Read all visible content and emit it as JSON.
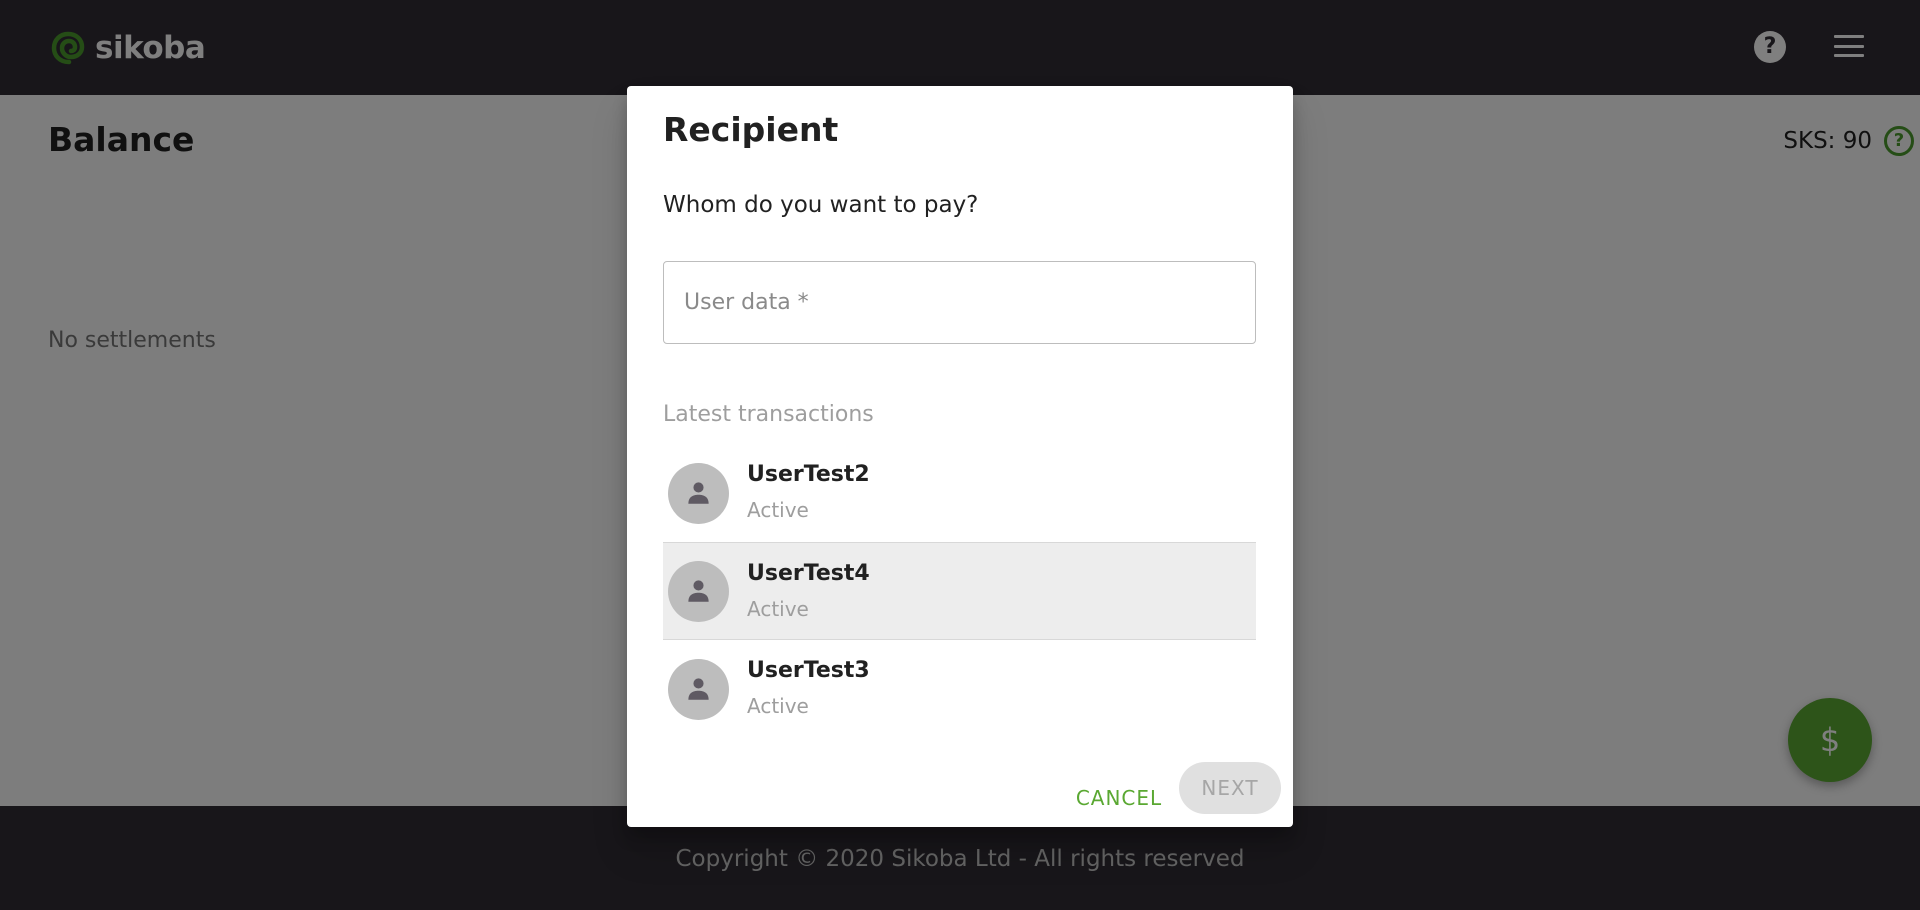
{
  "app": {
    "name": "sikoba",
    "logo_icon": "spiral-logo-icon",
    "brand_color": "#5aa832",
    "header_color": "#312d35",
    "help_icon": "help-circle-icon",
    "menu_icon": "hamburger-menu-icon"
  },
  "page": {
    "title": "Balance",
    "balance_text": "SKS: 90",
    "balance_help_icon": "help-circle-outline-icon",
    "empty_state": "No settlements",
    "fab_icon": "dollar-icon",
    "fab_label": "$"
  },
  "footer": {
    "text": "Copyright © 2020 Sikoba Ltd - All rights reserved"
  },
  "dialog": {
    "title": "Recipient",
    "question": "Whom do you want to pay?",
    "input_placeholder": "User data *",
    "input_value": "",
    "section_label": "Latest transactions",
    "recipients": [
      {
        "name": "UserTest2",
        "status": "Active",
        "avatar_icon": "person-icon",
        "selected": false
      },
      {
        "name": "UserTest4",
        "status": "Active",
        "avatar_icon": "person-icon",
        "selected": true
      },
      {
        "name": "UserTest3",
        "status": "Active",
        "avatar_icon": "person-icon",
        "selected": false
      }
    ],
    "cancel_label": "CANCEL",
    "next_label": "NEXT"
  }
}
